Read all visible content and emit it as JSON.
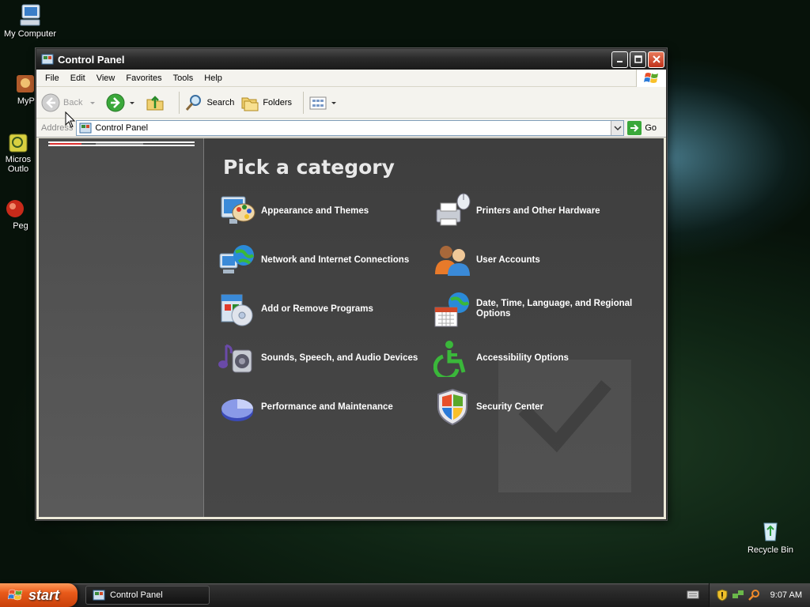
{
  "desktop": {
    "icons": [
      {
        "label": "My Computer"
      },
      {
        "label": "MyPa"
      },
      {
        "label": "Micros Outlo"
      },
      {
        "label": "Peg"
      },
      {
        "label": "Recycle Bin"
      }
    ]
  },
  "window": {
    "title": "Control Panel",
    "menu": [
      "File",
      "Edit",
      "View",
      "Favorites",
      "Tools",
      "Help"
    ],
    "toolbar": {
      "back": "Back",
      "search": "Search",
      "folders": "Folders"
    },
    "address": {
      "label": "Address",
      "value": "Control Panel",
      "go": "Go"
    },
    "main": {
      "heading": "Pick a category",
      "categories": [
        {
          "label": "Appearance and Themes",
          "icon": "appearance-icon"
        },
        {
          "label": "Printers and Other Hardware",
          "icon": "printer-icon"
        },
        {
          "label": "Network and Internet Connections",
          "icon": "network-icon"
        },
        {
          "label": "User Accounts",
          "icon": "users-icon"
        },
        {
          "label": "Add or Remove Programs",
          "icon": "programs-icon"
        },
        {
          "label": "Date, Time, Language, and Regional Options",
          "icon": "datetime-icon"
        },
        {
          "label": "Sounds, Speech, and Audio Devices",
          "icon": "sound-icon"
        },
        {
          "label": "Accessibility Options",
          "icon": "accessibility-icon"
        },
        {
          "label": "Performance and Maintenance",
          "icon": "performance-icon"
        },
        {
          "label": "Security Center",
          "icon": "shield-icon"
        }
      ]
    }
  },
  "taskbar": {
    "start": "start",
    "items": [
      {
        "label": "Control Panel"
      }
    ],
    "clock": "9:07 AM"
  }
}
